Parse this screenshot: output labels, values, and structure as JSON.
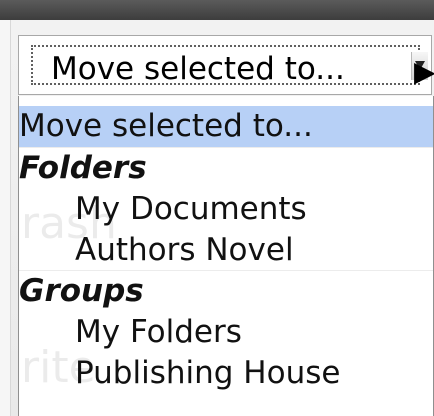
{
  "select": {
    "value": "Move selected to..."
  },
  "dropdown": {
    "selected_option": "Move selected to...",
    "groups": [
      {
        "label": "Folders",
        "items": [
          "My Documents",
          "Authors Novel"
        ]
      },
      {
        "label": "Groups",
        "items": [
          "My Folders",
          "Publishing House"
        ]
      }
    ]
  },
  "background": {
    "watermark_1": "rash",
    "watermark_2": "rite"
  }
}
